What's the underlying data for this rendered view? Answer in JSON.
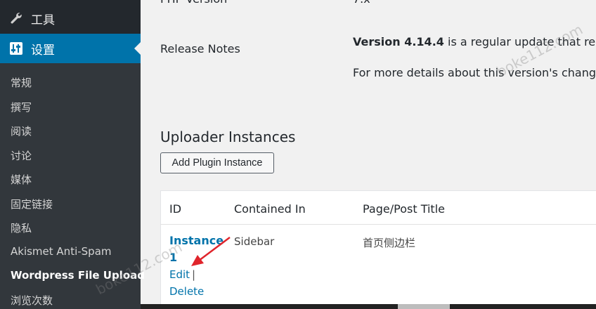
{
  "sidebar": {
    "tools_label": "工具",
    "settings_label": "设置",
    "items": [
      {
        "label": "常规"
      },
      {
        "label": "撰写"
      },
      {
        "label": "阅读"
      },
      {
        "label": "讨论"
      },
      {
        "label": "媒体"
      },
      {
        "label": "固定链接"
      },
      {
        "label": "隐私"
      },
      {
        "label": "Akismet Anti-Spam"
      },
      {
        "label": "Wordpress File Upload"
      },
      {
        "label": "浏览次数"
      }
    ]
  },
  "info": {
    "php_version_label": "PHP Version",
    "php_version_value": "7.x",
    "release_notes_label": "Release Notes",
    "release_version": "Version 4.14.4",
    "release_text": " is a regular update that restore",
    "release_more": "For more details about this version's changes"
  },
  "uploader": {
    "heading": "Uploader Instances",
    "add_button": "Add Plugin Instance",
    "columns": {
      "id": "ID",
      "contained_in": "Contained In",
      "page_title": "Page/Post Title"
    },
    "row": {
      "instance_line1": "Instance",
      "instance_line2": "1",
      "edit": "Edit",
      "separator": "|",
      "delete": "Delete",
      "contained_in": "Sidebar",
      "page_title": "首页侧边栏"
    }
  },
  "watermarks": [
    "boke112.com",
    "boke112.com"
  ],
  "colors": {
    "sidebar": "#23282d",
    "submenu": "#32373c",
    "accent": "#0073aa",
    "arrow": "#e0242b"
  }
}
